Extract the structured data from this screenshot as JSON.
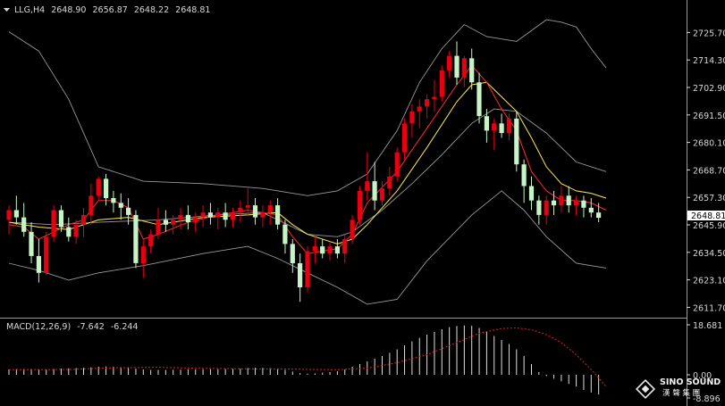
{
  "header": {
    "symbol": "LLG,H4",
    "open": "2648.90",
    "high": "2656.87",
    "low": "2648.22",
    "close": "2648.81"
  },
  "price_axis": {
    "ticks": [
      "2725.70",
      "2714.30",
      "2702.90",
      "2691.50",
      "2680.10",
      "2668.70",
      "2657.30",
      "2645.90",
      "2634.50",
      "2623.10",
      "2611.70"
    ],
    "current": "2648.81"
  },
  "macd": {
    "label": "MACD(12,26,9)",
    "main_value": "-7.642",
    "signal_value": "-6.244",
    "top_tick": "18.681",
    "zero_tick": "0.00",
    "bottom_tick": "-8.896"
  },
  "logo": {
    "name": "SINO SOUND",
    "subtitle": "漢 聲 集 團"
  },
  "colors": {
    "background": "#000000",
    "up_candle": "#e60012",
    "down_candle": "#c6f4c6",
    "bollinger": "#9a9a9a",
    "ma_fast": "#ff2a2a",
    "ma_slow": "#ffe85a",
    "macd_hist": "#e0e0e0",
    "macd_signal": "#e02020",
    "axis_text": "#d8d8d8"
  },
  "chart_data": {
    "type": "candlestick",
    "timeframe": "H4",
    "ylim": [
      2608.9,
      2731.4
    ],
    "grid": false,
    "candles": [
      [
        2648,
        2654,
        2642,
        2652
      ],
      [
        2652,
        2658,
        2646,
        2649
      ],
      [
        2649,
        2655,
        2641,
        2643
      ],
      [
        2643,
        2647,
        2630,
        2633
      ],
      [
        2633,
        2640,
        2622,
        2626
      ],
      [
        2626,
        2643,
        2625,
        2641
      ],
      [
        2641,
        2654,
        2639,
        2652
      ],
      [
        2652,
        2654,
        2643,
        2645
      ],
      [
        2645,
        2649,
        2639,
        2641
      ],
      [
        2641,
        2648,
        2638,
        2646
      ],
      [
        2646,
        2653,
        2641,
        2650
      ],
      [
        2650,
        2663,
        2646,
        2658
      ],
      [
        2658,
        2666,
        2656,
        2665
      ],
      [
        2665,
        2667,
        2654,
        2657
      ],
      [
        2657,
        2660,
        2651,
        2655
      ],
      [
        2655,
        2659,
        2648,
        2653
      ],
      [
        2653,
        2657,
        2646,
        2650
      ],
      [
        2650,
        2652,
        2628,
        2630
      ],
      [
        2630,
        2640,
        2624,
        2637
      ],
      [
        2637,
        2644,
        2634,
        2642
      ],
      [
        2642,
        2653,
        2640,
        2648
      ],
      [
        2648,
        2652,
        2643,
        2646
      ],
      [
        2646,
        2650,
        2642,
        2648
      ],
      [
        2648,
        2653,
        2644,
        2650
      ],
      [
        2650,
        2654,
        2644,
        2647
      ],
      [
        2647,
        2651,
        2643,
        2649
      ],
      [
        2649,
        2654,
        2645,
        2651
      ],
      [
        2651,
        2655,
        2646,
        2649
      ],
      [
        2649,
        2653,
        2644,
        2651
      ],
      [
        2651,
        2655,
        2645,
        2648
      ],
      [
        2648,
        2653,
        2645,
        2651
      ],
      [
        2651,
        2656,
        2647,
        2653
      ],
      [
        2653,
        2661,
        2650,
        2654
      ],
      [
        2654,
        2657,
        2646,
        2649
      ],
      [
        2649,
        2654,
        2645,
        2651
      ],
      [
        2651,
        2656,
        2646,
        2654
      ],
      [
        2654,
        2657,
        2644,
        2646
      ],
      [
        2646,
        2648,
        2634,
        2638
      ],
      [
        2638,
        2640,
        2626,
        2630
      ],
      [
        2630,
        2634,
        2614,
        2620
      ],
      [
        2620,
        2637,
        2618,
        2635
      ],
      [
        2635,
        2641,
        2630,
        2637
      ],
      [
        2637,
        2640,
        2632,
        2634
      ],
      [
        2634,
        2639,
        2631,
        2637
      ],
      [
        2637,
        2640,
        2632,
        2634
      ],
      [
        2634,
        2642,
        2630,
        2640
      ],
      [
        2640,
        2650,
        2638,
        2648
      ],
      [
        2648,
        2662,
        2646,
        2660
      ],
      [
        2660,
        2676,
        2656,
        2664
      ],
      [
        2664,
        2672,
        2652,
        2656
      ],
      [
        2656,
        2664,
        2654,
        2661
      ],
      [
        2661,
        2670,
        2658,
        2666
      ],
      [
        2666,
        2678,
        2664,
        2676
      ],
      [
        2676,
        2690,
        2673,
        2688
      ],
      [
        2688,
        2696,
        2682,
        2693
      ],
      [
        2693,
        2698,
        2686,
        2695
      ],
      [
        2695,
        2700,
        2690,
        2698
      ],
      [
        2698,
        2706,
        2693,
        2699
      ],
      [
        2699,
        2712,
        2697,
        2710
      ],
      [
        2710,
        2718,
        2707,
        2716
      ],
      [
        2716,
        2722,
        2704,
        2707
      ],
      [
        2707,
        2716,
        2703,
        2715
      ],
      [
        2715,
        2719,
        2702,
        2705
      ],
      [
        2705,
        2709,
        2688,
        2691
      ],
      [
        2691,
        2694,
        2680,
        2685
      ],
      [
        2685,
        2690,
        2677,
        2688
      ],
      [
        2688,
        2692,
        2682,
        2684
      ],
      [
        2684,
        2692,
        2681,
        2690
      ],
      [
        2690,
        2693,
        2668,
        2671
      ],
      [
        2671,
        2673,
        2655,
        2662
      ],
      [
        2662,
        2666,
        2652,
        2656
      ],
      [
        2656,
        2658,
        2646,
        2650
      ],
      [
        2650,
        2658,
        2646,
        2656
      ],
      [
        2656,
        2660,
        2650,
        2654
      ],
      [
        2654,
        2662,
        2651,
        2658
      ],
      [
        2658,
        2662,
        2651,
        2654
      ],
      [
        2654,
        2658,
        2650,
        2656
      ],
      [
        2656,
        2658,
        2649,
        2653
      ],
      [
        2653,
        2657,
        2649,
        2651
      ],
      [
        2651,
        2655,
        2647,
        2648.81
      ]
    ],
    "bollinger_bands": {
      "upper": [
        [
          0,
          2726
        ],
        [
          4,
          2718
        ],
        [
          8,
          2698
        ],
        [
          12,
          2670
        ],
        [
          18,
          2664
        ],
        [
          26,
          2663
        ],
        [
          34,
          2661
        ],
        [
          40,
          2658
        ],
        [
          44,
          2660
        ],
        [
          48,
          2667
        ],
        [
          52,
          2685
        ],
        [
          55,
          2705
        ],
        [
          58,
          2719
        ],
        [
          61,
          2729
        ],
        [
          64,
          2724
        ],
        [
          68,
          2722
        ],
        [
          72,
          2731
        ],
        [
          74,
          2730
        ],
        [
          76,
          2728
        ],
        [
          78,
          2719
        ],
        [
          80,
          2711
        ]
      ],
      "middle": [
        [
          0,
          2647
        ],
        [
          6,
          2646
        ],
        [
          12,
          2647
        ],
        [
          20,
          2648
        ],
        [
          28,
          2650
        ],
        [
          34,
          2651
        ],
        [
          40,
          2642
        ],
        [
          44,
          2641
        ],
        [
          46,
          2643
        ],
        [
          50,
          2652
        ],
        [
          54,
          2663
        ],
        [
          58,
          2675
        ],
        [
          62,
          2688
        ],
        [
          65,
          2694
        ],
        [
          68,
          2693
        ],
        [
          72,
          2684
        ],
        [
          76,
          2672
        ],
        [
          80,
          2668
        ]
      ],
      "lower": [
        [
          0,
          2630
        ],
        [
          4,
          2627
        ],
        [
          8,
          2623
        ],
        [
          12,
          2626
        ],
        [
          18,
          2629
        ],
        [
          26,
          2634
        ],
        [
          32,
          2637
        ],
        [
          36,
          2632
        ],
        [
          40,
          2626
        ],
        [
          44,
          2620
        ],
        [
          48,
          2613
        ],
        [
          52,
          2615
        ],
        [
          56,
          2631
        ],
        [
          62,
          2650
        ],
        [
          66,
          2660
        ],
        [
          69,
          2652
        ],
        [
          72,
          2641
        ],
        [
          76,
          2630
        ],
        [
          80,
          2628
        ]
      ]
    },
    "ma_fast": [
      [
        0,
        2646
      ],
      [
        2,
        2645
      ],
      [
        4,
        2640
      ],
      [
        6,
        2643
      ],
      [
        8,
        2646
      ],
      [
        10,
        2648
      ],
      [
        12,
        2656
      ],
      [
        14,
        2656
      ],
      [
        16,
        2653
      ],
      [
        18,
        2640
      ],
      [
        20,
        2642
      ],
      [
        24,
        2647
      ],
      [
        28,
        2650
      ],
      [
        32,
        2652
      ],
      [
        36,
        2650
      ],
      [
        38,
        2641
      ],
      [
        40,
        2634
      ],
      [
        44,
        2636
      ],
      [
        46,
        2642
      ],
      [
        48,
        2655
      ],
      [
        52,
        2668
      ],
      [
        56,
        2686
      ],
      [
        60,
        2704
      ],
      [
        62,
        2712
      ],
      [
        64,
        2705
      ],
      [
        66,
        2694
      ],
      [
        68,
        2685
      ],
      [
        70,
        2668
      ],
      [
        72,
        2660
      ],
      [
        74,
        2656
      ],
      [
        76,
        2656
      ],
      [
        78,
        2655
      ],
      [
        80,
        2652
      ]
    ],
    "ma_slow": [
      [
        0,
        2647
      ],
      [
        4,
        2645
      ],
      [
        8,
        2644
      ],
      [
        12,
        2648
      ],
      [
        16,
        2649
      ],
      [
        20,
        2646
      ],
      [
        26,
        2649
      ],
      [
        32,
        2650
      ],
      [
        36,
        2651
      ],
      [
        38,
        2646
      ],
      [
        40,
        2642
      ],
      [
        44,
        2638
      ],
      [
        46,
        2640
      ],
      [
        48,
        2646
      ],
      [
        52,
        2660
      ],
      [
        56,
        2678
      ],
      [
        60,
        2697
      ],
      [
        62,
        2704
      ],
      [
        64,
        2705
      ],
      [
        66,
        2699
      ],
      [
        68,
        2693
      ],
      [
        70,
        2682
      ],
      [
        72,
        2670
      ],
      [
        74,
        2663
      ],
      [
        76,
        2660
      ],
      [
        78,
        2659
      ],
      [
        80,
        2657
      ]
    ],
    "macd_histogram": [
      2.0,
      2.2,
      2.2,
      2.1,
      2.0,
      1.9,
      2.1,
      2.3,
      2.4,
      2.5,
      2.6,
      2.8,
      3.0,
      3.1,
      3.0,
      2.8,
      2.6,
      2.3,
      2.0,
      1.8,
      1.8,
      1.8,
      1.9,
      1.9,
      2.0,
      2.0,
      2.1,
      2.1,
      2.1,
      2.2,
      2.2,
      2.3,
      2.5,
      2.6,
      2.6,
      2.5,
      2.3,
      1.8,
      1.2,
      0.6,
      0.4,
      0.5,
      0.8,
      1.0,
      1.3,
      2.0,
      3.0,
      4.0,
      5.0,
      6.0,
      7.0,
      8.2,
      9.5,
      11.0,
      12.5,
      13.8,
      15.0,
      16.0,
      17.0,
      17.8,
      18.2,
      18.4,
      18.3,
      17.5,
      16.0,
      14.5,
      13.0,
      11.5,
      9.5,
      7.0,
      4.0,
      1.0,
      -0.5,
      -1.5,
      -2.5,
      -3.5,
      -4.5,
      -5.8,
      -6.8,
      -7.6
    ],
    "macd_signal": [
      [
        0,
        1.9
      ],
      [
        8,
        2.0
      ],
      [
        14,
        2.6
      ],
      [
        20,
        2.8
      ],
      [
        26,
        2.4
      ],
      [
        32,
        2.2
      ],
      [
        38,
        2.1
      ],
      [
        44,
        1.9
      ],
      [
        48,
        2.5
      ],
      [
        52,
        4.5
      ],
      [
        56,
        7.5
      ],
      [
        60,
        12.0
      ],
      [
        63,
        15.5
      ],
      [
        66,
        17.3
      ],
      [
        68,
        17.5
      ],
      [
        70,
        16.8
      ],
      [
        72,
        15.0
      ],
      [
        74,
        12.0
      ],
      [
        76,
        7.5
      ],
      [
        78,
        2.0
      ],
      [
        80,
        -4.5
      ]
    ]
  }
}
